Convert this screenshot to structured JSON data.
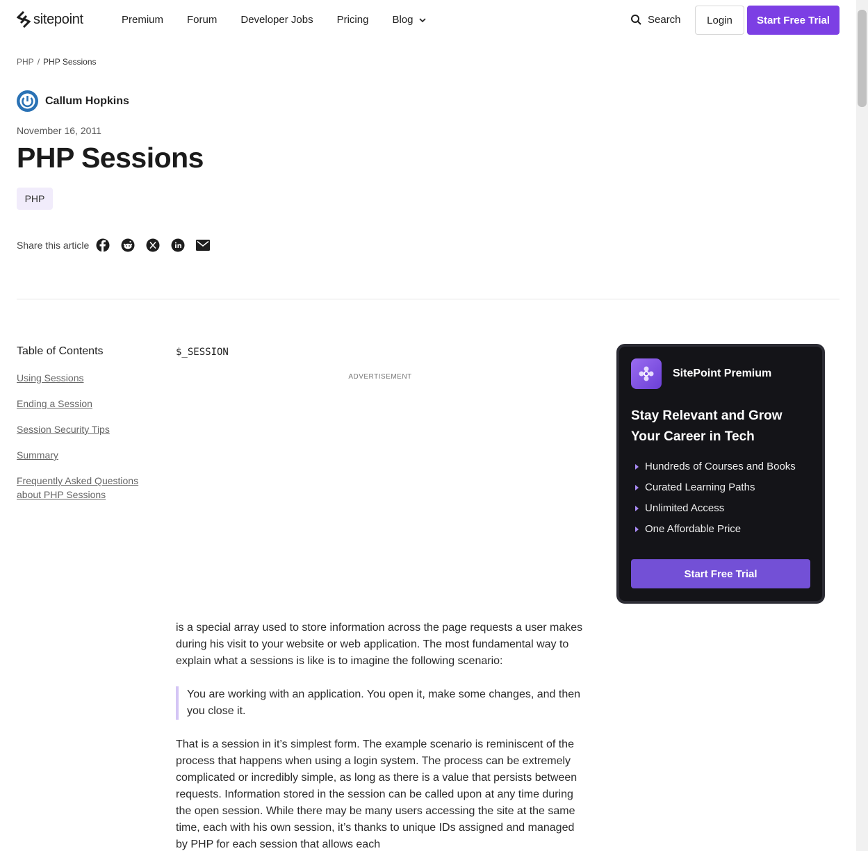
{
  "header": {
    "logo_text": "sitepoint",
    "nav": [
      {
        "label": "Premium"
      },
      {
        "label": "Forum"
      },
      {
        "label": "Developer Jobs"
      },
      {
        "label": "Pricing"
      },
      {
        "label": "Blog"
      }
    ],
    "search_label": "Search",
    "login_label": "Login",
    "trial_label": "Start Free Trial"
  },
  "breadcrumb": {
    "parent": "PHP",
    "separator": "/",
    "current": "PHP Sessions"
  },
  "article": {
    "author": "Callum Hopkins",
    "date": "November 16, 2011",
    "title": "PHP Sessions",
    "tag": "PHP",
    "share_label": "Share this article",
    "code_var": "$_SESSION",
    "ad_label": "ADVERTISEMENT",
    "p1": "is a special array used to store information across the page requests a user makes during his visit to your website or web application. The most fundamental way to explain what a sessions is like is to imagine the following scenario:",
    "quote": "You are working with an application. You open it, make some changes, and then you close it.",
    "p2": "That is a session in it’s simplest form. The example scenario is reminiscent of the process that happens when using a login system. The process can be extremely complicated or incredibly simple, as long as there is a value that persists between requests. Information stored in the session can be called upon at any time during the open session. While there may be many users accessing the site at the same time, each with his own session, it’s thanks to unique IDs assigned and managed by PHP for each session that allows each"
  },
  "toc": {
    "title": "Table of Contents",
    "items": [
      {
        "label": "Using Sessions"
      },
      {
        "label": "Ending a Session"
      },
      {
        "label": "Session Security Tips"
      },
      {
        "label": "Summary"
      },
      {
        "label": "Frequently Asked Questions about PHP Sessions"
      }
    ]
  },
  "promo": {
    "name": "SitePoint Premium",
    "headline": "Stay Relevant and Grow Your Career in Tech",
    "items": [
      "Hundreds of Courses and Books",
      "Curated Learning Paths",
      "Unlimited Access",
      "One Affordable Price"
    ],
    "button": "Start Free Trial"
  },
  "colors": {
    "accent": "#7c3fe4",
    "promo_bg": "#141418",
    "tag_bg": "#f1ecfb"
  }
}
